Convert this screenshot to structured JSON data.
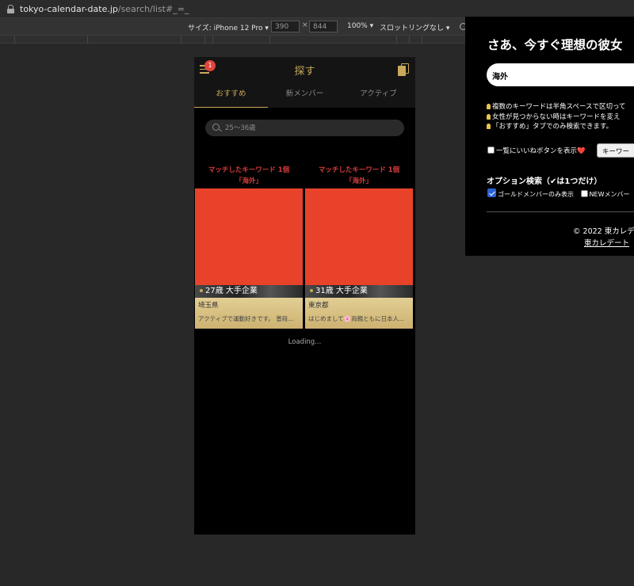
{
  "browser": {
    "url_host": "tokyo-calendar-date.jp",
    "url_path": "/search/list#_=_"
  },
  "devtools": {
    "size_label": "サイズ: iPhone 12 Pro ▾",
    "width": "390",
    "height": "844",
    "times": "×",
    "zoom": "100% ▾",
    "throttle": "スロットリングなし ▾"
  },
  "app": {
    "header_title": "探す",
    "notification_count": "1",
    "tabs": [
      {
        "label": "おすすめ",
        "active": true
      },
      {
        "label": "新メンバー",
        "active": false
      },
      {
        "label": "アクティブ",
        "active": false
      }
    ],
    "search_placeholder": "25〜36歳",
    "cards": [
      {
        "match_line1": "マッチしたキーワード 1個",
        "match_line2": "「海外」",
        "age": "27歳 大手企業",
        "prefecture": "埼玉県",
        "bio": "アクティブで運動好きです。 普段..."
      },
      {
        "match_line1": "マッチしたキーワード 1個",
        "match_line2": "「海外」",
        "age": "31歳 大手企業",
        "prefecture": "東京都",
        "bio": "はじめまして🌸両親ともに日本人..."
      }
    ],
    "loading": "Loading..."
  },
  "panel": {
    "title": "さあ、今すぐ理想の彼女",
    "keyword_value": "海外",
    "tips": [
      "複数のキーワードは半角スペースで区切って",
      "女性が見つからない時はキーワードを変え",
      "「おすすめ」タブでのみ検索できます。"
    ],
    "like_label": "一覧にいいねボタンを表示",
    "heart": "❤️",
    "keyword_button": "キーワー",
    "option_title": "オプション検索（✔︎は1つだけ）",
    "option_gold": "ゴールドメンバーのみ表示",
    "option_new": "NEWメンバー",
    "footer_copyright": "© 2022 東カレデ",
    "footer_link": "東カレデート"
  },
  "colors": {
    "gold": "#c9a95a",
    "match_red": "#d33c3c",
    "badge_red": "#e0453c",
    "photo_redact": "#e8432a"
  }
}
